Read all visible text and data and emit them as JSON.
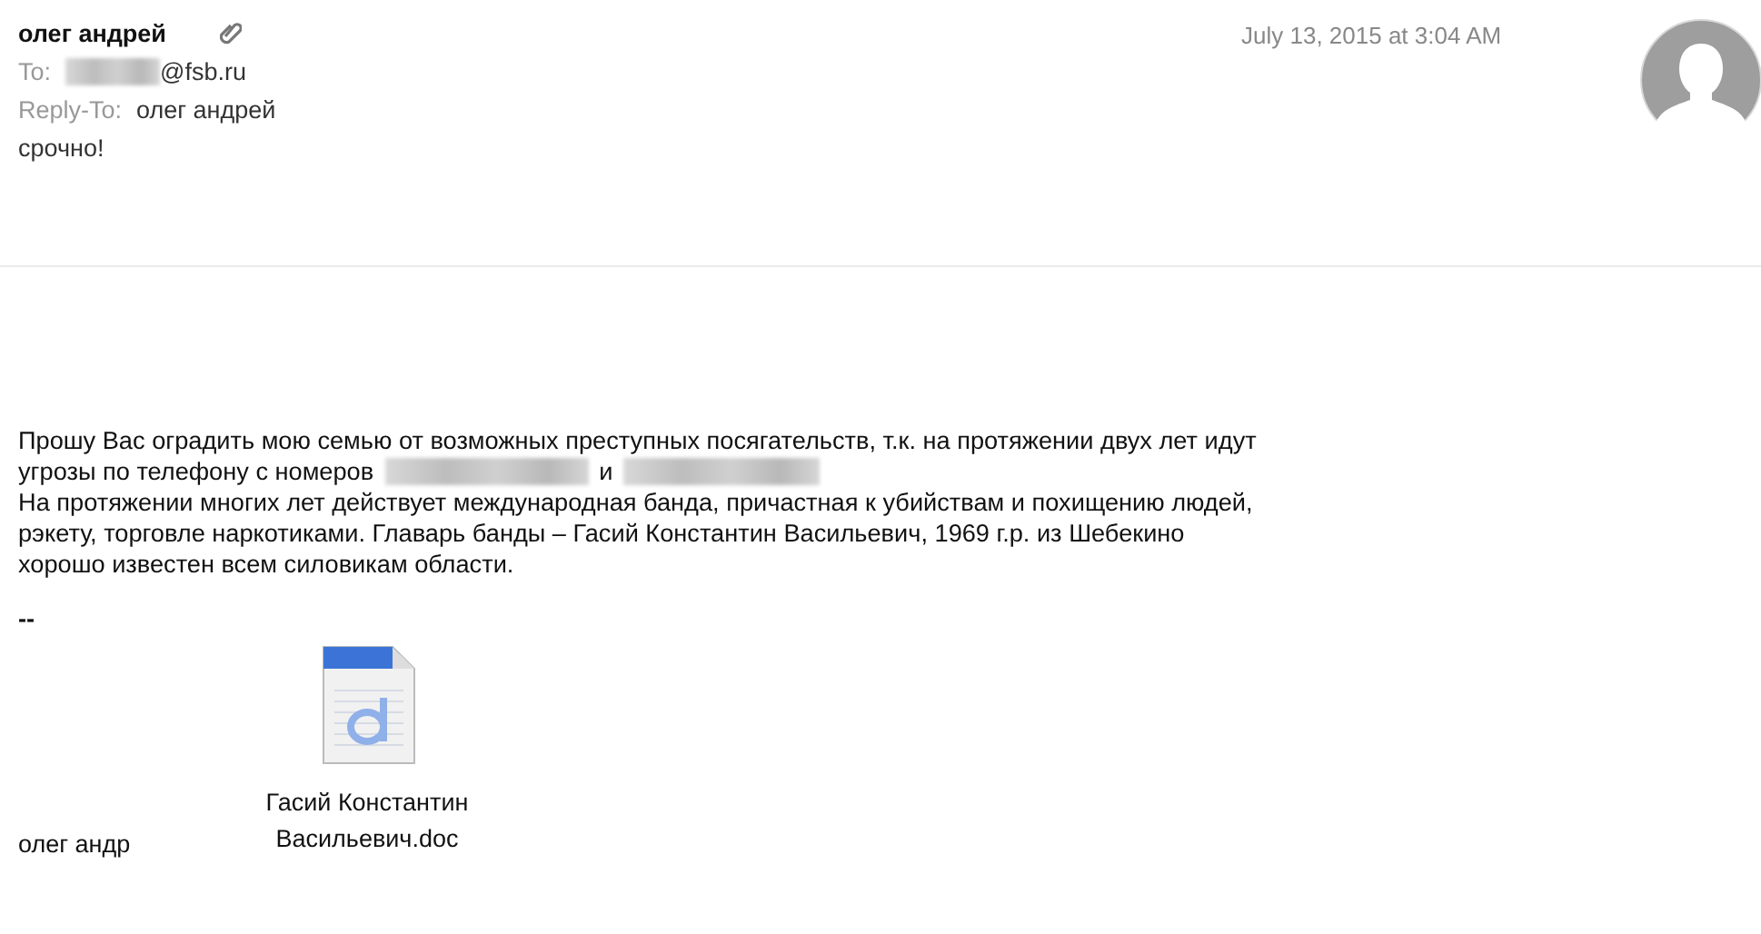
{
  "header": {
    "sender": "олег андрей",
    "has_attachment": true,
    "to_label": "To:",
    "to_value": "@fsb.ru",
    "to_redacted": true,
    "reply_to_label": "Reply-To:",
    "reply_to_value": "олег андрей",
    "subject": "срочно!",
    "date": "July 13, 2015 at 3:04 AM"
  },
  "body": {
    "lines": [
      [
        {
          "kind": "text",
          "text": "Прошу Вас оградить мою семью от возможных преступных посягательств, т.к. на протяжении двух лет идут"
        }
      ],
      [
        {
          "kind": "text",
          "text": "угрозы по телефону с номеров"
        },
        {
          "kind": "redacted"
        },
        {
          "kind": "text",
          "text": "и"
        },
        {
          "kind": "redacted"
        }
      ],
      [
        {
          "kind": "text",
          "text": "На протяжении многих лет действует международная банда, причастная к убийствам и похищению людей,"
        }
      ],
      [
        {
          "kind": "text",
          "text": "рэкету, торговле наркотиками. Главарь банды – Гасий Константин Васильевич, 1969 г.р. из Шебекино"
        }
      ],
      [
        {
          "kind": "text",
          "text": "хорошо известен всем силовикам области."
        }
      ]
    ],
    "signature_separator": "--",
    "signature": "олег андр"
  },
  "attachment": {
    "name_lines": [
      "Гасий Константин",
      "Васильевич.doc"
    ]
  }
}
